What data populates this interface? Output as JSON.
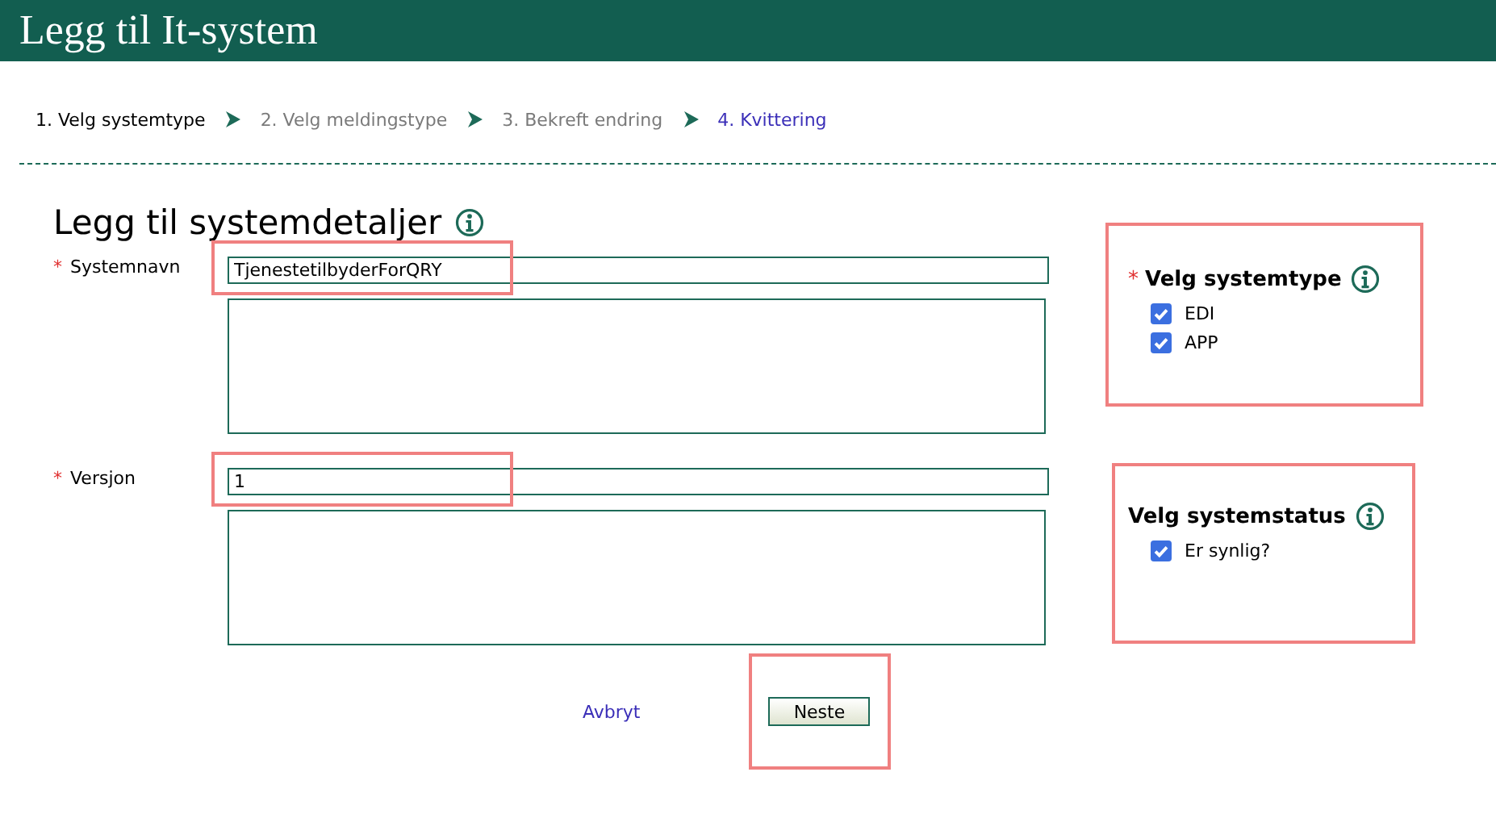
{
  "header": {
    "title": "Legg til It-system"
  },
  "steps": [
    {
      "label": "1. Velg systemtype",
      "kind": "current"
    },
    {
      "label": "2. Velg meldingstype",
      "kind": "inactive"
    },
    {
      "label": "3. Bekreft endring",
      "kind": "inactive"
    },
    {
      "label": "4. Kvittering",
      "kind": "link"
    }
  ],
  "form": {
    "heading": "Legg til systemdetaljer",
    "fields": [
      {
        "required_mark": "*",
        "label": "Systemnavn",
        "value": "TjenestetilbyderForQRY",
        "highlighted": true
      },
      {
        "required_mark": "*",
        "label": "Versjon",
        "value": "1",
        "highlighted": true
      }
    ]
  },
  "panels": [
    {
      "required_mark": "*",
      "title": "Velg systemtype",
      "highlighted": true,
      "options": [
        {
          "label": "EDI",
          "checked": true
        },
        {
          "label": "APP",
          "checked": true
        }
      ]
    },
    {
      "title": "Velg systemstatus",
      "highlighted": true,
      "options": [
        {
          "label": "Er synlig?",
          "checked": true
        }
      ]
    }
  ],
  "actions": {
    "cancel": "Avbryt",
    "next": "Neste",
    "next_highlighted": true
  }
}
